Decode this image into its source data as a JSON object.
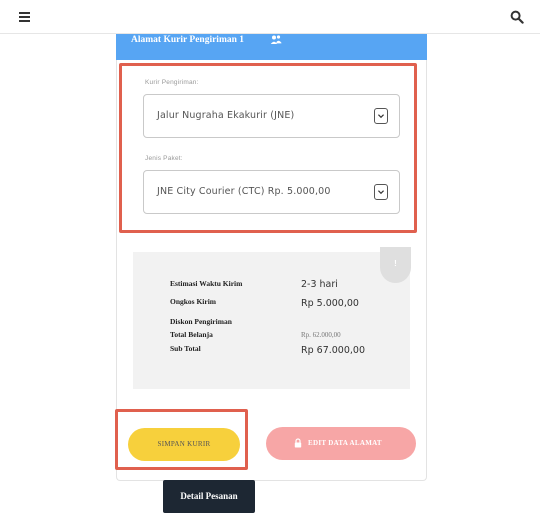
{
  "topbar": {
    "menu_icon": "hamburger-menu-icon",
    "search_icon": "search-icon"
  },
  "card": {
    "title": "Alamat Kurir Pengiriman 1",
    "title_icon": "users-icon"
  },
  "form": {
    "courier_label": "Kurir Pengiriman:",
    "courier_value": "Jalur Nugraha Ekakurir (JNE)",
    "package_label": "Jenis Paket:",
    "package_value": "JNE City Courier (CTC) Rp. 5.000,00"
  },
  "summary": {
    "info_badge": "!",
    "rows": [
      {
        "label": "Estimasi Waktu Kirim",
        "value": "2-3 hari"
      },
      {
        "label": "Ongkos Kirim",
        "value": "Rp 5.000,00"
      },
      {
        "label": "Diskon Pengiriman",
        "value": ""
      },
      {
        "label": "Total Belanja",
        "value": "Rp. 62.000,00"
      },
      {
        "label": "Sub Total",
        "value": "Rp 67.000,00"
      }
    ]
  },
  "buttons": {
    "save_label": "SIMPAN KURIR",
    "edit_label": "EDIT DATA ALAMAT",
    "detail_label": "Detail Pesanan"
  },
  "colors": {
    "header_blue": "#57a5f3",
    "highlight_red": "#e0604e",
    "save_yellow": "#f7d03c",
    "edit_pink": "#f7a6a6",
    "detail_dark": "#1d2733"
  }
}
